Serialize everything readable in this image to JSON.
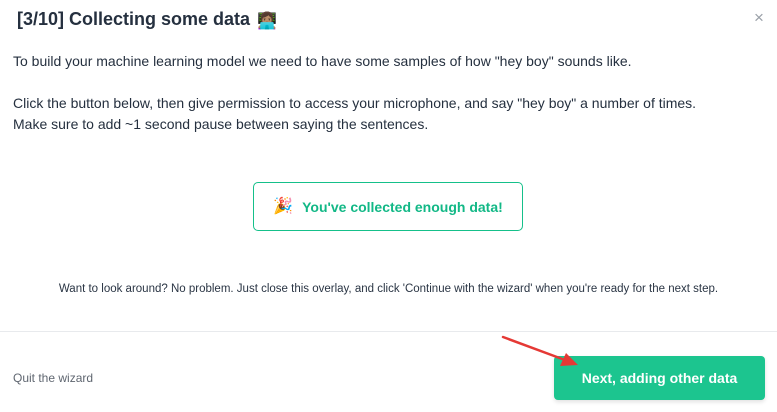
{
  "dialog": {
    "title": "[3/10] Collecting some data",
    "title_icon": "👩🏽‍💻",
    "close_label": "×"
  },
  "content": {
    "intro": "To build your machine learning model we need to have some samples of how \"hey boy\" sounds like.",
    "instruction_line1": "Click the button below, then give permission to access your microphone, and say \"hey boy\" a number of times.",
    "instruction_line2": "Make sure to add ~1 second pause between saying the sentences.",
    "status_icon": "🎉",
    "status_text": "You've collected enough data!",
    "hint": "Want to look around? No problem. Just close this overlay, and click 'Continue with the wizard' when you're ready for the next step."
  },
  "footer": {
    "quit_label": "Quit the wizard",
    "next_label": "Next, adding other data"
  },
  "colors": {
    "accent": "#1cc58f",
    "arrow": "#e53935"
  }
}
